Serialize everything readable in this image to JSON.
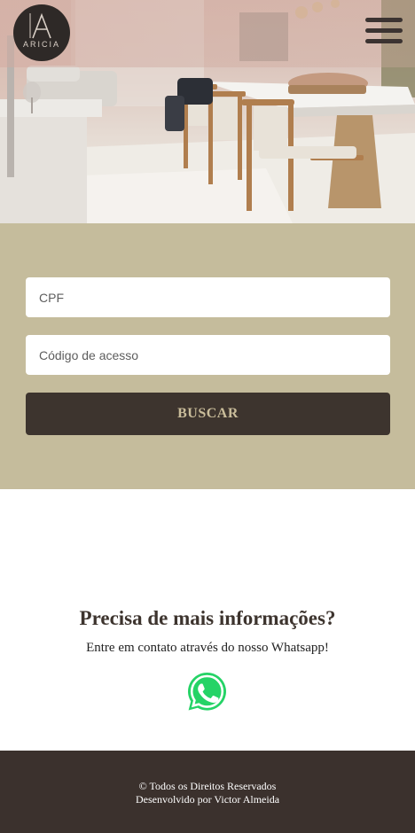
{
  "header": {
    "logo_text": "ARICIA",
    "menu_icon": "hamburger-icon"
  },
  "hero": {
    "image": "dining-room-photo"
  },
  "login": {
    "cpf_placeholder": "CPF",
    "code_placeholder": "Código de acesso",
    "search_label": "BUSCAR"
  },
  "contact": {
    "title": "Precisa de mais informações?",
    "text": "Entre em contato através do nosso Whatsapp!",
    "icon": "whatsapp-icon"
  },
  "footer": {
    "rights": "© Todos os Direitos Reservados",
    "developer": "Desenvolvido por Victor Almeida"
  },
  "colors": {
    "form_background": "#c5bc9c",
    "button_background": "#3d342e",
    "button_text": "#c9bc9a",
    "footer_background": "#3b312d",
    "whatsapp_green": "#25d366"
  }
}
